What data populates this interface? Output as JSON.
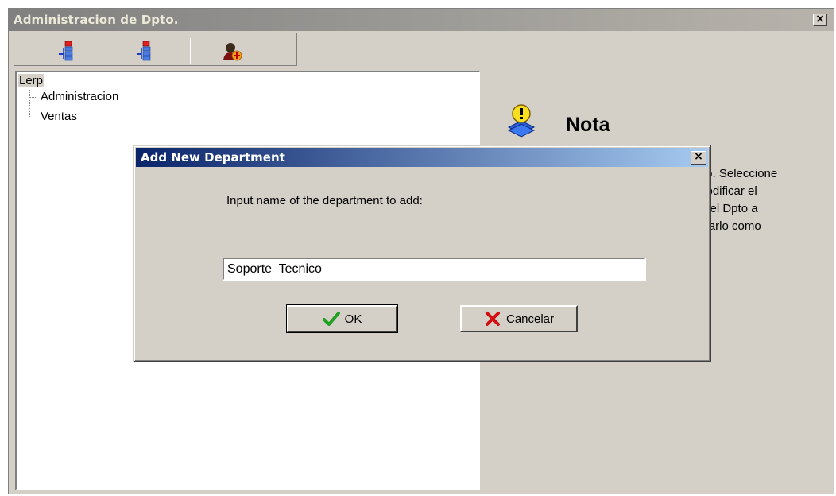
{
  "window": {
    "title": "Administracion de Dpto.",
    "close_label": "×"
  },
  "toolbar": {
    "buttons": [
      {
        "name": "add-department",
        "icon": "tree-add-icon"
      },
      {
        "name": "add-subdepartment",
        "icon": "tree-add-icon"
      },
      {
        "name": "assign-user",
        "icon": "user-add-icon"
      }
    ]
  },
  "tree": {
    "root": "Lerp",
    "children": [
      "Administracion",
      "Ventas"
    ]
  },
  "nota": {
    "icon": "warning-stack-icon",
    "title": "Nota",
    "lines": [
      "to. Seleccione",
      "modificar el",
      "ar el Dpto a",
      "ocarlo como"
    ]
  },
  "dialog": {
    "title": "Add New Department",
    "close_label": "×",
    "prompt": "Input name of the department to add:",
    "input_value": "Soporte  Tecnico",
    "ok_label": "OK",
    "cancel_label": "Cancelar",
    "ok_icon": "checkmark-icon",
    "cancel_icon": "x-mark-icon"
  },
  "colors": {
    "dialog_title_start": "#0a246a",
    "dialog_title_end": "#a6caf0",
    "window_bg": "#d4d0c8"
  }
}
